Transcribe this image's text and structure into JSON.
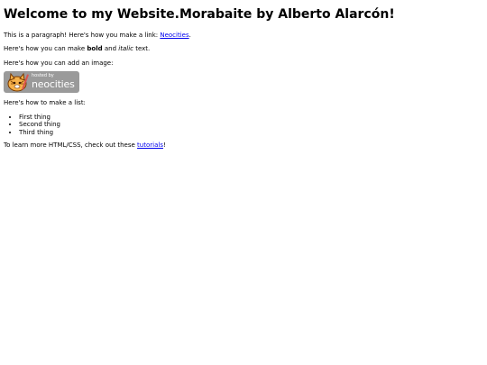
{
  "page": {
    "heading": "Welcome to my Website.Morabaite by Alberto Alarcón!",
    "para1": {
      "before": "This is a paragraph! Here's how you make a link: ",
      "link": "Neocities",
      "after": "."
    },
    "para2": {
      "before": "Here's how you can make ",
      "bold": "bold",
      "middle": " and ",
      "italic": "italic",
      "after": " text."
    },
    "para3": "Here's how you can add an image:",
    "badge": {
      "hosted": "hosted by",
      "brand": "neocities",
      "background": "#9a9a9a"
    },
    "list_intro": "Here's how to make a list:",
    "list": [
      "First thing",
      "Second thing",
      "Third thing"
    ],
    "para_last": {
      "before": "To learn more HTML/CSS, check out these ",
      "link": "tutorials",
      "after": "!"
    },
    "link_color": "#0000ee"
  }
}
